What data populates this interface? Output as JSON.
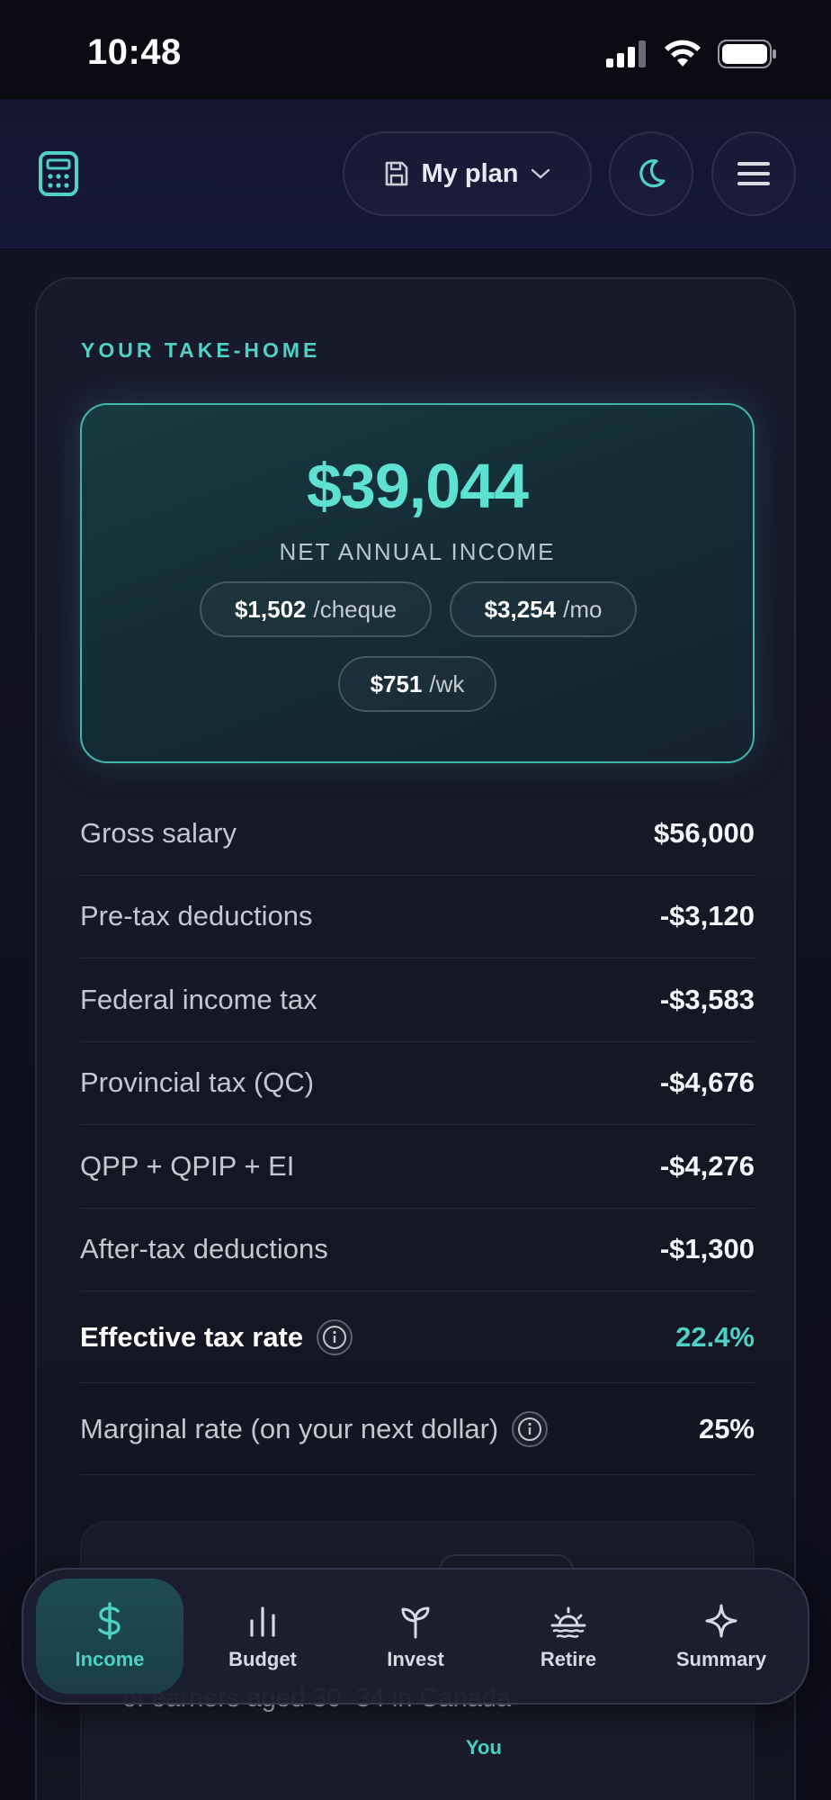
{
  "status_bar": {
    "time": "10:48"
  },
  "header": {
    "plan_label": "My plan"
  },
  "take_home": {
    "eyebrow": "YOUR TAKE-HOME",
    "net_amount": "$39,044",
    "net_label": "NET ANNUAL INCOME",
    "pills": [
      {
        "amount": "$1,502",
        "unit": "/cheque"
      },
      {
        "amount": "$3,254",
        "unit": "/mo"
      },
      {
        "amount": "$751",
        "unit": "/wk"
      }
    ]
  },
  "breakdown": [
    {
      "label": "Gross salary",
      "value": "$56,000"
    },
    {
      "label": "Pre-tax deductions",
      "value": "-$3,120"
    },
    {
      "label": "Federal income tax",
      "value": "-$3,583"
    },
    {
      "label": "Provincial tax (QC)",
      "value": "-$4,676"
    },
    {
      "label": "QPP + QPIP + EI",
      "value": "-$4,276"
    },
    {
      "label": "After-tax deductions",
      "value": "-$1,300"
    },
    {
      "label": "Effective tax rate",
      "value": "22.4%"
    },
    {
      "label": "Marginal rate (on your next dollar)",
      "value": "25%"
    }
  ],
  "percentile": {
    "text": "of earners aged 30–34 in Canada",
    "you_label": "You"
  },
  "tabs": [
    {
      "label": "Income",
      "icon": "dollar-icon"
    },
    {
      "label": "Budget",
      "icon": "bar-chart-icon"
    },
    {
      "label": "Invest",
      "icon": "sprout-icon"
    },
    {
      "label": "Retire",
      "icon": "sunset-icon"
    },
    {
      "label": "Summary",
      "icon": "sparkle-icon"
    }
  ],
  "colors": {
    "accent": "#4fd1c5",
    "background": "#0c0c16",
    "card": "#161827"
  }
}
